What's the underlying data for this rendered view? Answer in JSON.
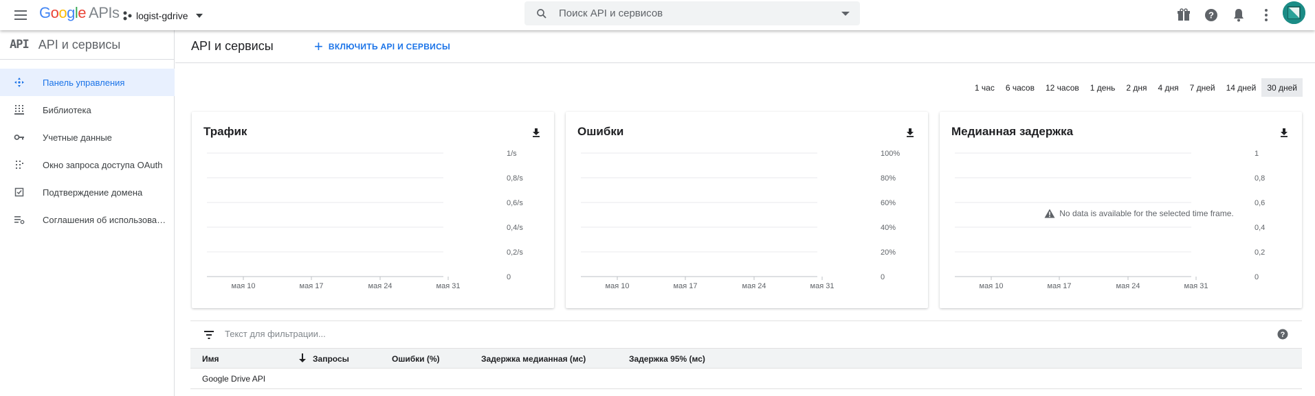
{
  "topbar": {
    "logo_google": "Google",
    "logo_apis": "APIs",
    "project_name": "logist-gdrive",
    "search_placeholder": "Поиск API и сервисов"
  },
  "sidebar": {
    "title": "API и сервисы",
    "logo_text": "API",
    "items": [
      {
        "label": "Панель управления",
        "icon": "dashboard-icon",
        "active": true
      },
      {
        "label": "Библиотека",
        "icon": "library-icon",
        "active": false
      },
      {
        "label": "Учетные данные",
        "icon": "key-icon",
        "active": false
      },
      {
        "label": "Окно запроса доступа OAuth",
        "icon": "oauth-consent-icon",
        "active": false
      },
      {
        "label": "Подтверждение домена",
        "icon": "checkbox-icon",
        "active": false
      },
      {
        "label": "Соглашения об использовании",
        "icon": "agreements-icon",
        "active": false
      }
    ]
  },
  "header": {
    "title": "API и сервисы",
    "enable_button": "ВКЛЮЧИТЬ API И СЕРВИСЫ"
  },
  "time_ranges": [
    "1 час",
    "6 часов",
    "12 часов",
    "1 день",
    "2 дня",
    "4 дня",
    "7 дней",
    "14 дней",
    "30 дней"
  ],
  "selected_range": "30 дней",
  "cards": [
    {
      "title": "Трафик"
    },
    {
      "title": "Ошибки"
    },
    {
      "title": "Медианная задержка",
      "no_data": "No data is available for the selected time frame."
    }
  ],
  "chart_data": [
    {
      "type": "line",
      "title": "Трафик",
      "x_ticks": [
        "мая 10",
        "мая 17",
        "мая 24",
        "мая 31"
      ],
      "y_ticks": [
        "0",
        "0,2/s",
        "0,4/s",
        "0,6/s",
        "0,8/s",
        "1/s"
      ],
      "ylim": [
        0,
        1
      ],
      "series": [],
      "grid": true
    },
    {
      "type": "line",
      "title": "Ошибки",
      "x_ticks": [
        "мая 10",
        "мая 17",
        "мая 24",
        "мая 31"
      ],
      "y_ticks": [
        "0",
        "20%",
        "40%",
        "60%",
        "80%",
        "100%"
      ],
      "ylim": [
        0,
        100
      ],
      "series": [],
      "grid": true
    },
    {
      "type": "line",
      "title": "Медианная задержка",
      "x_ticks": [
        "мая 10",
        "мая 17",
        "мая 24",
        "мая 31"
      ],
      "y_ticks": [
        "0",
        "0,2",
        "0,4",
        "0,6",
        "0,8",
        "1"
      ],
      "ylim": [
        0,
        1
      ],
      "series": [],
      "grid": true
    }
  ],
  "filter": {
    "placeholder": "Текст для фильтрации..."
  },
  "table": {
    "columns": [
      "Имя",
      "Запросы",
      "Ошибки (%)",
      "Задержка медианная (мс)",
      "Задержка 95% (мс)"
    ],
    "rows": [
      {
        "name": "Google Drive API",
        "requests": "",
        "errors": "",
        "latency_median": "",
        "latency_95": ""
      }
    ]
  }
}
